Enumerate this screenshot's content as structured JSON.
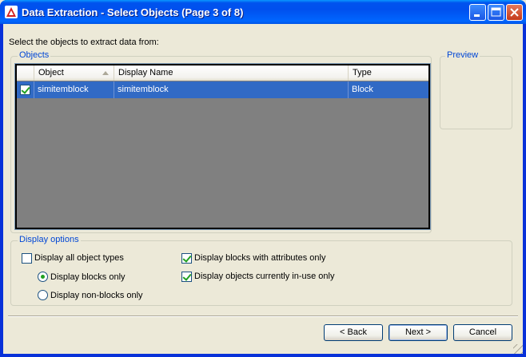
{
  "window": {
    "title": "Data Extraction - Select Objects (Page 3 of 8)"
  },
  "prompt": "Select the objects to extract data from:",
  "objects_group": {
    "title": "Objects",
    "columns": [
      "Object",
      "Display Name",
      "Type"
    ],
    "rows": [
      {
        "checked": true,
        "object": "simitemblock",
        "display_name": "simitemblock",
        "type": "Block",
        "selected": true
      }
    ]
  },
  "preview_group": {
    "title": "Preview"
  },
  "display_options": {
    "title": "Display options",
    "display_all_types": {
      "label": "Display all object types",
      "checked": false
    },
    "blocks_only": {
      "label": "Display blocks only",
      "selected": true
    },
    "non_blocks_only": {
      "label": "Display non-blocks only",
      "selected": false
    },
    "blocks_with_attributes": {
      "label": "Display blocks with attributes only",
      "checked": true
    },
    "objects_in_use": {
      "label": "Display objects currently in-use only",
      "checked": true
    }
  },
  "buttons": {
    "back": "< Back",
    "next": "Next >",
    "cancel": "Cancel"
  },
  "colors": {
    "title_bar": "#0054E3",
    "selection": "#316AC5",
    "group_title": "#0046D5",
    "list_background": "#808080",
    "dialog_background": "#ECE9D8"
  }
}
